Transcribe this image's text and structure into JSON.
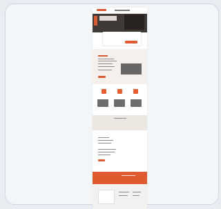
{
  "preview": {
    "label": "",
    "colors": {
      "accent": "#df5b2f",
      "background": "#e9edf2",
      "card": "#f3f6f9",
      "dark": "#3f3a36"
    }
  }
}
